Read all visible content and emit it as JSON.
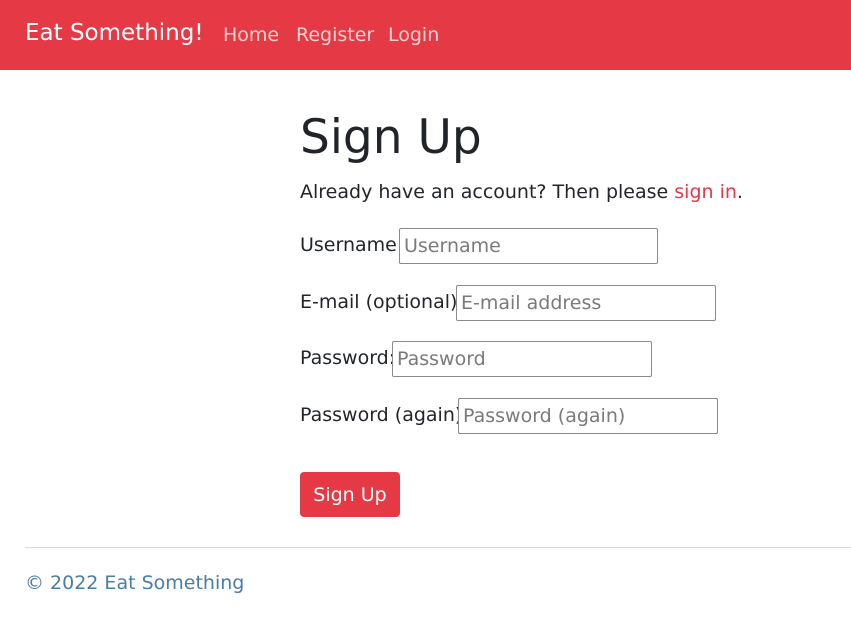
{
  "navbar": {
    "brand": "Eat Something!",
    "links": [
      "Home",
      "Register",
      "Login"
    ]
  },
  "page": {
    "title": "Sign Up",
    "intro_prefix": "Already have an account? Then please ",
    "intro_link": "sign in",
    "intro_suffix": "."
  },
  "form": {
    "username": {
      "label": "Username:",
      "placeholder": "Username",
      "value": ""
    },
    "email": {
      "label": "E-mail (optional):",
      "placeholder": "E-mail address",
      "value": ""
    },
    "password": {
      "label": "Password:",
      "placeholder": "Password",
      "value": ""
    },
    "password2": {
      "label": "Password (again):",
      "placeholder": "Password (again)",
      "value": ""
    },
    "submit_label": "Sign Up"
  },
  "footer": {
    "text": "© 2022 Eat Something"
  },
  "colors": {
    "brand": "#e63946",
    "nav_link": "#ffd1cf",
    "footer_text": "#4a7da3"
  }
}
